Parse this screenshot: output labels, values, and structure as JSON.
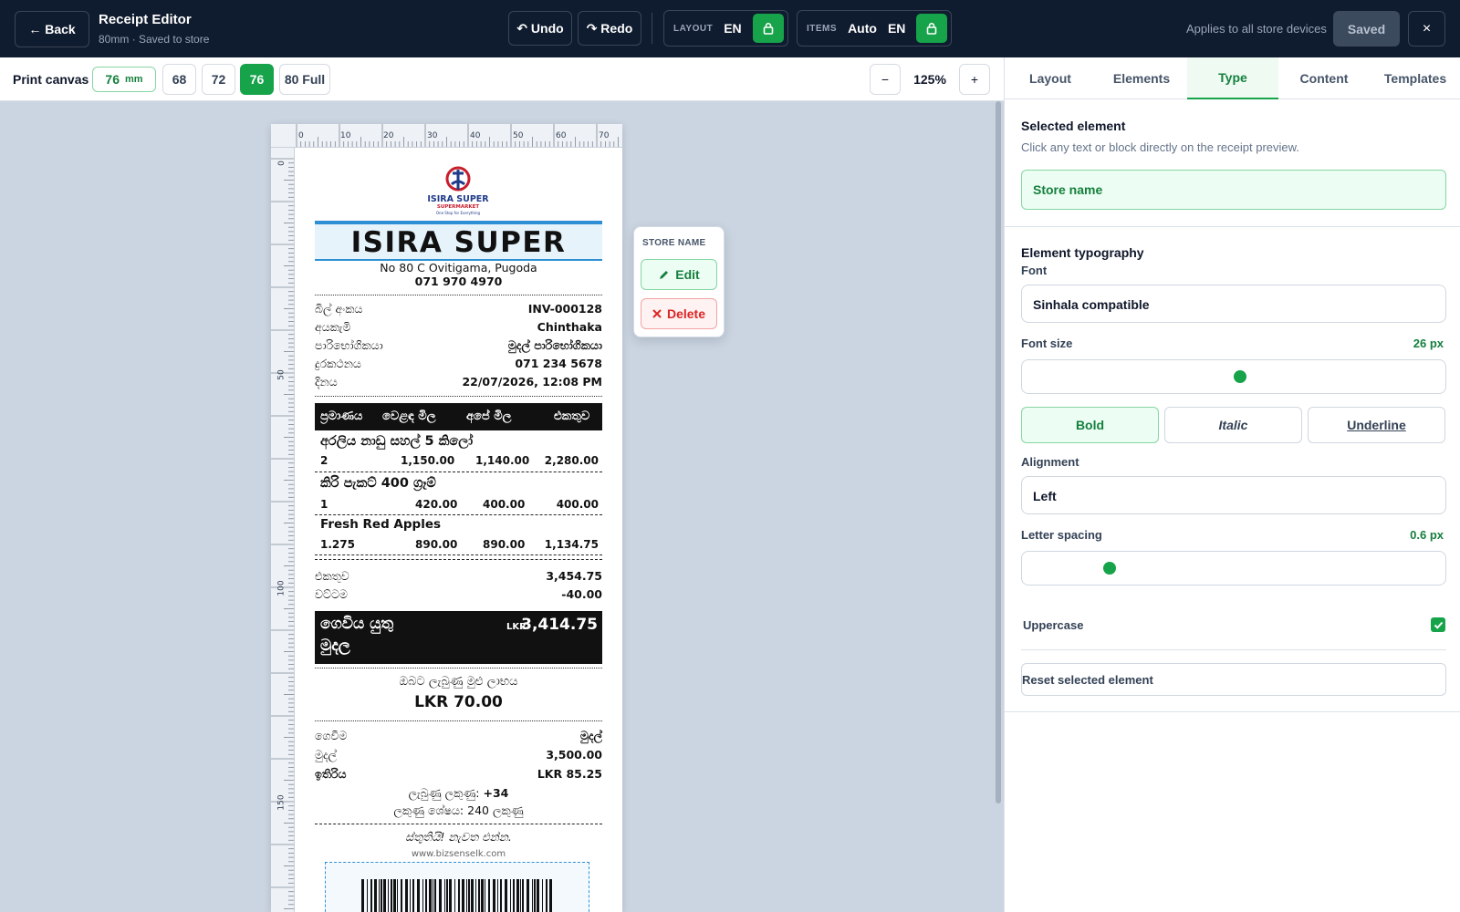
{
  "header": {
    "back_label": "← Back",
    "title": "Receipt Editor",
    "subtitle": "80mm · Saved to store",
    "undo_label": "↶ Undo",
    "redo_label": "↷ Redo",
    "layout_group": {
      "label": "LAYOUT",
      "language": "EN",
      "locked": true
    },
    "items_group": {
      "label": "ITEMS",
      "mode": "Auto",
      "language": "EN",
      "locked": true
    },
    "applies_text": "Applies to all store devices",
    "saved_label": "Saved",
    "close_label": "×"
  },
  "canvas_toolbar": {
    "label": "Print canvas",
    "width_value": "76",
    "width_unit": "mm",
    "width_options": [
      "68",
      "72",
      "76",
      "80 Full"
    ],
    "active_width": "76",
    "zoom_out": "−",
    "zoom_level": "125%",
    "zoom_in": "+"
  },
  "rulers": {
    "top_marks": [
      "0",
      "10",
      "20",
      "30",
      "40",
      "50",
      "60",
      "70"
    ],
    "left_marks": [
      "0",
      "50",
      "100",
      "150"
    ]
  },
  "receipt": {
    "logo_text": "ISIRA SUPER",
    "logo_sub": "SUPERMARKET",
    "logo_tagline": "One Stop for Everything",
    "store_name": "ISIRA SUPER",
    "address": "No 80 C Ovitigama, Pugoda",
    "phone": "071 970 4970",
    "info_rows": [
      {
        "label": "බිල් අංකය",
        "value": "INV-000128"
      },
      {
        "label": "අයකැමි",
        "value": "Chinthaka"
      },
      {
        "label": "පාරිභෝගිකයා",
        "value": "මුදල් පාරිභෝගිකයා"
      },
      {
        "label": "දුරකථනය",
        "value": "071 234 5678"
      },
      {
        "label": "දිනය",
        "value": "22/07/2026, 12:08 PM"
      }
    ],
    "table_headers": [
      "ප්‍රමාණය",
      "වෙළඳ මිල",
      "අපේ මිල",
      "එකතුව"
    ],
    "items": [
      {
        "name": "අරලිය නාඩු සහල් 5 කිලෝ",
        "qty": "2",
        "market_price": "1,150.00",
        "our_price": "1,140.00",
        "total": "2,280.00"
      },
      {
        "name": "කිරි පැකට් 400 ග්‍රෑම්",
        "qty": "1",
        "market_price": "420.00",
        "our_price": "400.00",
        "total": "400.00"
      },
      {
        "name": "Fresh Red Apples",
        "qty": "1.275",
        "market_price": "890.00",
        "our_price": "890.00",
        "total": "1,134.75"
      }
    ],
    "subtotal_label": "එකතුව",
    "subtotal_value": "3,454.75",
    "discount_label": "වට්ටම",
    "discount_value": "-40.00",
    "payable_label_1": "ගෙවිය යුතු",
    "payable_label_2": "මුදල",
    "payable_currency": "LKR",
    "payable_value": "3,414.75",
    "savings_label": "ඔබට ලැබුණු මුළු ලාභය",
    "savings_value": "LKR 70.00",
    "payment_rows": [
      {
        "label": "ගෙවීම",
        "value": "මුදල්"
      },
      {
        "label": "මුදල්",
        "value": "3,500.00"
      },
      {
        "label": "ඉතිරිය",
        "value": "LKR 85.25"
      }
    ],
    "points_earned_label": "ලැබුණු ලකුණු:",
    "points_earned_value": "+34",
    "points_balance": "ලකුණු ශේෂය: 240 ලකුණු",
    "thanks": "ස්තුතියි! නැවත එන්න.",
    "website": "www.bizsenselk.com"
  },
  "popup": {
    "title": "STORE NAME",
    "edit_label": "Edit",
    "delete_label": "Delete"
  },
  "panel": {
    "tabs": [
      "Layout",
      "Elements",
      "Type",
      "Content",
      "Templates"
    ],
    "active_tab": "Type",
    "selected_heading": "Selected element",
    "selected_desc": "Click any text or block directly on the receipt preview.",
    "selected_value": "Store name",
    "typography_heading": "Element typography",
    "font_label": "Font",
    "font_value": "Sinhala compatible",
    "font_size_label": "Font size",
    "font_size_value": "26 px",
    "style_bold": "Bold",
    "style_italic": "Italic",
    "style_underline": "Underline",
    "alignment_label": "Alignment",
    "alignment_value": "Left",
    "letter_spacing_label": "Letter spacing",
    "letter_spacing_value": "0.6 px",
    "uppercase_label": "Uppercase",
    "uppercase_checked": true,
    "reset_label": "Reset selected element"
  },
  "colors": {
    "topbar": "#0f1b2e",
    "accent": "#16a34a",
    "danger": "#dc2626"
  }
}
